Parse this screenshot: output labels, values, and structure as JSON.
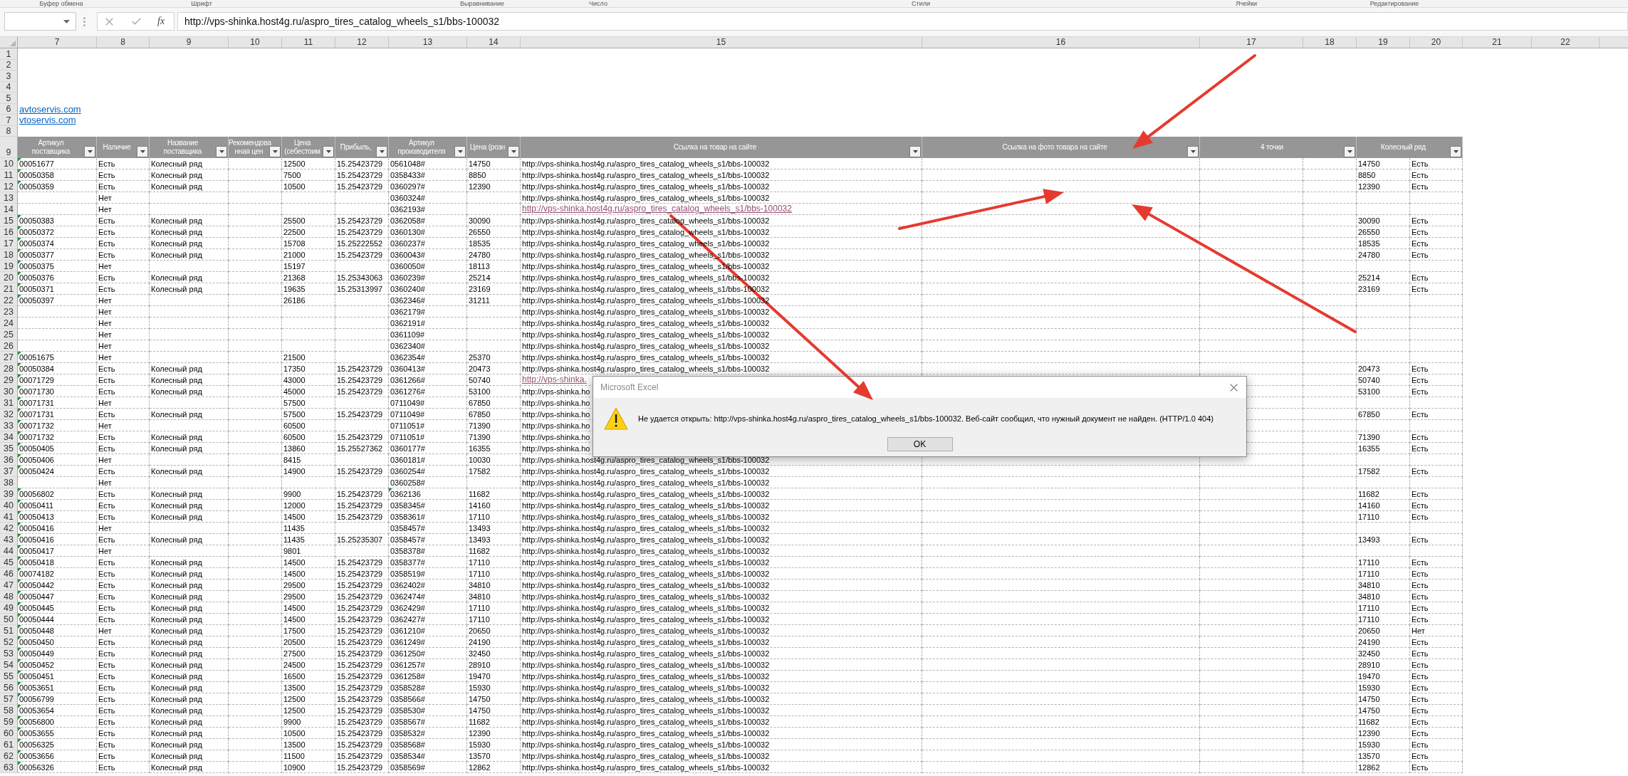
{
  "ribbon_groups": [
    "Буфер обмена",
    "Шрифт",
    "Выравнивание",
    "Число",
    "Стили",
    "Ячейки",
    "Редактирование"
  ],
  "formula_bar": {
    "function_label": "fx",
    "value": "http://vps-shinka.host4g.ru/aspro_tires_catalog_wheels_s1/bbs-100032"
  },
  "column_headers": [
    "7",
    "8",
    "9",
    "10",
    "11",
    "12",
    "13",
    "14",
    "15",
    "16",
    "17",
    "18",
    "19",
    "20",
    "21",
    "22"
  ],
  "top_rows": [
    {
      "row": "1"
    },
    {
      "row": "2"
    },
    {
      "row": "3"
    },
    {
      "row": "4"
    },
    {
      "row": "5"
    },
    {
      "row": "6",
      "text": "avtoservis.com"
    },
    {
      "row": "7",
      "text": "vtoservis.com"
    },
    {
      "row": "8"
    }
  ],
  "table": {
    "row": "9",
    "columns": [
      "Артикул\nпоставщика",
      "Наличие",
      "Название\nпоставщика",
      "Рекомендова\nнная цен",
      "Цена\n(себестоим",
      "Прибыль,",
      "Артикул\nпроизводителя",
      "Цена (розн",
      "Ссылка на товар на сайте",
      "Ссылка на фото товара на сайте",
      "4 точки",
      "Колесный ряд"
    ]
  },
  "rows": [
    {
      "row": "10",
      "article": "00051677",
      "article_flag": true,
      "stock": "Есть",
      "supplier": "Колесный ряд",
      "cost": "12500",
      "profit": "15.25423729",
      "maker_article": "0561048#",
      "maker_flag": false,
      "retail": "14750",
      "link": "http://vps-shinka.host4g.ru/aspro_tires_catalog_wheels_s1/bbs-100032",
      "link_followed": false,
      "column_19": "14750",
      "column_20": "Есть"
    },
    {
      "row": "11",
      "article": "00050358",
      "article_flag": true,
      "stock": "Есть",
      "supplier": "Колесный ряд",
      "cost": "7500",
      "profit": "15.25423729",
      "maker_article": "0358433#",
      "maker_flag": false,
      "retail": "8850",
      "link": "http://vps-shinka.host4g.ru/aspro_tires_catalog_wheels_s1/bbs-100032",
      "link_followed": false,
      "column_19": "8850",
      "column_20": "Есть"
    },
    {
      "row": "12",
      "article": "00050359",
      "article_flag": true,
      "stock": "Есть",
      "supplier": "Колесный ряд",
      "cost": "10500",
      "profit": "15.25423729",
      "maker_article": "0360297#",
      "maker_flag": false,
      "retail": "12390",
      "link": "http://vps-shinka.host4g.ru/aspro_tires_catalog_wheels_s1/bbs-100032",
      "link_followed": false,
      "column_19": "12390",
      "column_20": "Есть"
    },
    {
      "row": "13",
      "article_flag": false,
      "stock": "Нет",
      "maker_article": "0360324#",
      "maker_flag": false,
      "link": "http://vps-shinka.host4g.ru/aspro_tires_catalog_wheels_s1/bbs-100032",
      "link_followed": false
    },
    {
      "row": "14",
      "article_flag": false,
      "stock": "Нет",
      "maker_article": "0362193#",
      "maker_flag": false,
      "link": "http://vps-shinka.host4g.ru/aspro_tires_catalog_wheels_s1/bbs-100032",
      "link_followed": true
    },
    {
      "row": "15",
      "article": "00050383",
      "article_flag": true,
      "stock": "Есть",
      "supplier": "Колесный ряд",
      "cost": "25500",
      "profit": "15.25423729",
      "maker_article": "0362058#",
      "maker_flag": false,
      "retail": "30090",
      "link": "http://vps-shinka.host4g.ru/aspro_tires_catalog_wheels_s1/bbs-100032",
      "link_followed": false,
      "column_19": "30090",
      "column_20": "Есть"
    },
    {
      "row": "16",
      "article": "00050372",
      "article_flag": true,
      "stock": "Есть",
      "supplier": "Колесный ряд",
      "cost": "22500",
      "profit": "15.25423729",
      "maker_article": "0360130#",
      "maker_flag": false,
      "retail": "26550",
      "link": "http://vps-shinka.host4g.ru/aspro_tires_catalog_wheels_s1/bbs-100032",
      "link_followed": false,
      "column_19": "26550",
      "column_20": "Есть"
    },
    {
      "row": "17",
      "article": "00050374",
      "article_flag": true,
      "stock": "Есть",
      "supplier": "Колесный ряд",
      "cost": "15708",
      "profit": "15.25222552",
      "maker_article": "0360237#",
      "maker_flag": false,
      "retail": "18535",
      "link": "http://vps-shinka.host4g.ru/aspro_tires_catalog_wheels_s1/bbs-100032",
      "link_followed": false,
      "column_19": "18535",
      "column_20": "Есть"
    },
    {
      "row": "18",
      "article": "00050377",
      "article_flag": true,
      "stock": "Есть",
      "supplier": "Колесный ряд",
      "cost": "21000",
      "profit": "15.25423729",
      "maker_article": "0360043#",
      "maker_flag": false,
      "retail": "24780",
      "link": "http://vps-shinka.host4g.ru/aspro_tires_catalog_wheels_s1/bbs-100032",
      "link_followed": false,
      "column_19": "24780",
      "column_20": "Есть"
    },
    {
      "row": "19",
      "article": "00050375",
      "article_flag": true,
      "stock": "Нет",
      "cost": "15197",
      "maker_article": "0360050#",
      "maker_flag": false,
      "retail": "18113",
      "link": "http://vps-shinka.host4g.ru/aspro_tires_catalog_wheels_s1/bbs-100032",
      "link_followed": false
    },
    {
      "row": "20",
      "article": "00050376",
      "article_flag": true,
      "stock": "Есть",
      "supplier": "Колесный ряд",
      "cost": "21368",
      "profit": "15.25343063",
      "maker_article": "0360239#",
      "maker_flag": false,
      "retail": "25214",
      "link": "http://vps-shinka.host4g.ru/aspro_tires_catalog_wheels_s1/bbs-100032",
      "link_followed": false,
      "column_19": "25214",
      "column_20": "Есть"
    },
    {
      "row": "21",
      "article": "00050371",
      "article_flag": true,
      "stock": "Есть",
      "supplier": "Колесный ряд",
      "cost": "19635",
      "profit": "15.25313997",
      "maker_article": "0360240#",
      "maker_flag": false,
      "retail": "23169",
      "link": "http://vps-shinka.host4g.ru/aspro_tires_catalog_wheels_s1/bbs-100032",
      "link_followed": false,
      "column_19": "23169",
      "column_20": "Есть"
    },
    {
      "row": "22",
      "article": "00050397",
      "article_flag": true,
      "stock": "Нет",
      "cost": "26186",
      "maker_article": "0362346#",
      "maker_flag": false,
      "retail": "31211",
      "link": "http://vps-shinka.host4g.ru/aspro_tires_catalog_wheels_s1/bbs-100032",
      "link_followed": false
    },
    {
      "row": "23",
      "article_flag": false,
      "stock": "Нет",
      "maker_article": "0362179#",
      "maker_flag": false,
      "link": "http://vps-shinka.host4g.ru/aspro_tires_catalog_wheels_s1/bbs-100032",
      "link_followed": false
    },
    {
      "row": "24",
      "article_flag": false,
      "stock": "Нет",
      "maker_article": "0362191#",
      "maker_flag": false,
      "link": "http://vps-shinka.host4g.ru/aspro_tires_catalog_wheels_s1/bbs-100032",
      "link_followed": false
    },
    {
      "row": "25",
      "article_flag": false,
      "stock": "Нет",
      "maker_article": "0361109#",
      "maker_flag": false,
      "link": "http://vps-shinka.host4g.ru/aspro_tires_catalog_wheels_s1/bbs-100032",
      "link_followed": false
    },
    {
      "row": "26",
      "article_flag": false,
      "stock": "Нет",
      "maker_article": "0362340#",
      "maker_flag": false,
      "link": "http://vps-shinka.host4g.ru/aspro_tires_catalog_wheels_s1/bbs-100032",
      "link_followed": false
    },
    {
      "row": "27",
      "article": "00051675",
      "article_flag": true,
      "stock": "Нет",
      "cost": "21500",
      "maker_article": "0362354#",
      "maker_flag": false,
      "retail": "25370",
      "link": "http://vps-shinka.host4g.ru/aspro_tires_catalog_wheels_s1/bbs-100032",
      "link_followed": false
    },
    {
      "row": "28",
      "article": "00050384",
      "article_flag": true,
      "stock": "Есть",
      "supplier": "Колесный ряд",
      "cost": "17350",
      "profit": "15.25423729",
      "maker_article": "0360413#",
      "maker_flag": false,
      "retail": "20473",
      "link": "http://vps-shinka.host4g.ru/aspro_tires_catalog_wheels_s1/bbs-100032",
      "link_followed": false,
      "column_19": "20473",
      "column_20": "Есть"
    },
    {
      "row": "29",
      "article": "00071729",
      "article_flag": true,
      "stock": "Есть",
      "supplier": "Колесный ряд",
      "cost": "43000",
      "profit": "15.25423729",
      "maker_article": "0361266#",
      "maker_flag": false,
      "retail": "50740",
      "link": "http://vps-shinka.",
      "link_followed": true,
      "column_19": "50740",
      "column_20": "Есть"
    },
    {
      "row": "30",
      "article": "00071730",
      "article_flag": true,
      "stock": "Есть",
      "supplier": "Колесный ряд",
      "cost": "45000",
      "profit": "15.25423729",
      "maker_article": "0361276#",
      "maker_flag": false,
      "retail": "53100",
      "link": "http://vps-shinka.ho",
      "link_followed": false,
      "column_19": "53100",
      "column_20": "Есть"
    },
    {
      "row": "31",
      "article": "00071731",
      "article_flag": true,
      "stock": "Нет",
      "cost": "57500",
      "maker_article": "0711049#",
      "maker_flag": false,
      "retail": "67850",
      "link": "http://vps-shinka.ho",
      "link_followed": false
    },
    {
      "row": "32",
      "article": "00071731",
      "article_flag": true,
      "stock": "Есть",
      "supplier": "Колесный ряд",
      "cost": "57500",
      "profit": "15.25423729",
      "maker_article": "0711049#",
      "maker_flag": false,
      "retail": "67850",
      "link": "http://vps-shinka.ho",
      "link_followed": false,
      "column_19": "67850",
      "column_20": "Есть"
    },
    {
      "row": "33",
      "article": "00071732",
      "article_flag": true,
      "stock": "Нет",
      "cost": "60500",
      "maker_article": "0711051#",
      "maker_flag": false,
      "retail": "71390",
      "link": "http://vps-shinka.ho",
      "link_followed": false
    },
    {
      "row": "34",
      "article": "00071732",
      "article_flag": true,
      "stock": "Есть",
      "supplier": "Колесный ряд",
      "cost": "60500",
      "profit": "15.25423729",
      "maker_article": "0711051#",
      "maker_flag": false,
      "retail": "71390",
      "link": "http://vps-shinka.ho",
      "link_followed": false,
      "column_19": "71390",
      "column_20": "Есть"
    },
    {
      "row": "35",
      "article": "00050405",
      "article_flag": true,
      "stock": "Есть",
      "supplier": "Колесный ряд",
      "cost": "13860",
      "profit": "15.25527362",
      "maker_article": "0360177#",
      "maker_flag": false,
      "retail": "16355",
      "link": "http://vps-shinka.ho",
      "link_followed": false,
      "column_19": "16355",
      "column_20": "Есть"
    },
    {
      "row": "36",
      "article": "00050406",
      "article_flag": true,
      "stock": "Нет",
      "cost": "8415",
      "maker_article": "0360181#",
      "maker_flag": false,
      "retail": "10030",
      "link": "http://vps-shinka.host4g.ru/aspro_tires_catalog_wheels_s1/bbs-100032",
      "link_followed": false
    },
    {
      "row": "37",
      "article": "00050424",
      "article_flag": true,
      "stock": "Есть",
      "supplier": "Колесный ряд",
      "cost": "14900",
      "profit": "15.25423729",
      "maker_article": "0360254#",
      "maker_flag": false,
      "retail": "17582",
      "link": "http://vps-shinka.host4g.ru/aspro_tires_catalog_wheels_s1/bbs-100032",
      "link_followed": false,
      "column_19": "17582",
      "column_20": "Есть"
    },
    {
      "row": "38",
      "article_flag": false,
      "stock": "Нет",
      "maker_article": "0360258#",
      "maker_flag": false,
      "link": "http://vps-shinka.host4g.ru/aspro_tires_catalog_wheels_s1/bbs-100032",
      "link_followed": false
    },
    {
      "row": "39",
      "article": "00056802",
      "article_flag": true,
      "stock": "Есть",
      "supplier": "Колесный ряд",
      "cost": "9900",
      "profit": "15.25423729",
      "maker_article": "0362136",
      "maker_flag": true,
      "retail": "11682",
      "link": "http://vps-shinka.host4g.ru/aspro_tires_catalog_wheels_s1/bbs-100032",
      "link_followed": false,
      "column_19": "11682",
      "column_20": "Есть"
    },
    {
      "row": "40",
      "article": "00050411",
      "article_flag": true,
      "stock": "Есть",
      "supplier": "Колесный ряд",
      "cost": "12000",
      "profit": "15.25423729",
      "maker_article": "0358345#",
      "maker_flag": false,
      "retail": "14160",
      "link": "http://vps-shinka.host4g.ru/aspro_tires_catalog_wheels_s1/bbs-100032",
      "link_followed": false,
      "column_19": "14160",
      "column_20": "Есть"
    },
    {
      "row": "41",
      "article": "00050413",
      "article_flag": true,
      "stock": "Есть",
      "supplier": "Колесный ряд",
      "cost": "14500",
      "profit": "15.25423729",
      "maker_article": "0358361#",
      "maker_flag": false,
      "retail": "17110",
      "link": "http://vps-shinka.host4g.ru/aspro_tires_catalog_wheels_s1/bbs-100032",
      "link_followed": false,
      "column_19": "17110",
      "column_20": "Есть"
    },
    {
      "row": "42",
      "article": "00050416",
      "article_flag": true,
      "stock": "Нет",
      "cost": "11435",
      "maker_article": "0358457#",
      "maker_flag": false,
      "retail": "13493",
      "link": "http://vps-shinka.host4g.ru/aspro_tires_catalog_wheels_s1/bbs-100032",
      "link_followed": false
    },
    {
      "row": "43",
      "article": "00050416",
      "article_flag": true,
      "stock": "Есть",
      "supplier": "Колесный ряд",
      "cost": "11435",
      "profit": "15.25235307",
      "maker_article": "0358457#",
      "maker_flag": false,
      "retail": "13493",
      "link": "http://vps-shinka.host4g.ru/aspro_tires_catalog_wheels_s1/bbs-100032",
      "link_followed": false,
      "column_19": "13493",
      "column_20": "Есть"
    },
    {
      "row": "44",
      "article": "00050417",
      "article_flag": true,
      "stock": "Нет",
      "cost": "9801",
      "maker_article": "0358378#",
      "maker_flag": false,
      "retail": "11682",
      "link": "http://vps-shinka.host4g.ru/aspro_tires_catalog_wheels_s1/bbs-100032",
      "link_followed": false
    },
    {
      "row": "45",
      "article": "00050418",
      "article_flag": true,
      "stock": "Есть",
      "supplier": "Колесный ряд",
      "cost": "14500",
      "profit": "15.25423729",
      "maker_article": "0358377#",
      "maker_flag": false,
      "retail": "17110",
      "link": "http://vps-shinka.host4g.ru/aspro_tires_catalog_wheels_s1/bbs-100032",
      "link_followed": false,
      "column_19": "17110",
      "column_20": "Есть"
    },
    {
      "row": "46",
      "article": "00074182",
      "article_flag": true,
      "stock": "Есть",
      "supplier": "Колесный ряд",
      "cost": "14500",
      "profit": "15.25423729",
      "maker_article": "0358519#",
      "maker_flag": false,
      "retail": "17110",
      "link": "http://vps-shinka.host4g.ru/aspro_tires_catalog_wheels_s1/bbs-100032",
      "link_followed": false,
      "column_19": "17110",
      "column_20": "Есть"
    },
    {
      "row": "47",
      "article": "00050442",
      "article_flag": true,
      "stock": "Есть",
      "supplier": "Колесный ряд",
      "cost": "29500",
      "profit": "15.25423729",
      "maker_article": "0362402#",
      "maker_flag": false,
      "retail": "34810",
      "link": "http://vps-shinka.host4g.ru/aspro_tires_catalog_wheels_s1/bbs-100032",
      "link_followed": false,
      "column_19": "34810",
      "column_20": "Есть"
    },
    {
      "row": "48",
      "article": "00050447",
      "article_flag": true,
      "stock": "Есть",
      "supplier": "Колесный ряд",
      "cost": "29500",
      "profit": "15.25423729",
      "maker_article": "0362474#",
      "maker_flag": false,
      "retail": "34810",
      "link": "http://vps-shinka.host4g.ru/aspro_tires_catalog_wheels_s1/bbs-100032",
      "link_followed": false,
      "column_19": "34810",
      "column_20": "Есть"
    },
    {
      "row": "49",
      "article": "00050445",
      "article_flag": true,
      "stock": "Есть",
      "supplier": "Колесный ряд",
      "cost": "14500",
      "profit": "15.25423729",
      "maker_article": "0362429#",
      "maker_flag": false,
      "retail": "17110",
      "link": "http://vps-shinka.host4g.ru/aspro_tires_catalog_wheels_s1/bbs-100032",
      "link_followed": false,
      "column_19": "17110",
      "column_20": "Есть"
    },
    {
      "row": "50",
      "article": "00050444",
      "article_flag": true,
      "stock": "Есть",
      "supplier": "Колесный ряд",
      "cost": "14500",
      "profit": "15.25423729",
      "maker_article": "0362427#",
      "maker_flag": false,
      "retail": "17110",
      "link": "http://vps-shinka.host4g.ru/aspro_tires_catalog_wheels_s1/bbs-100032",
      "link_followed": false,
      "column_19": "17110",
      "column_20": "Есть"
    },
    {
      "row": "51",
      "article": "00050448",
      "article_flag": true,
      "stock": "Нет",
      "supplier": "Колесный ряд",
      "cost": "17500",
      "profit": "15.25423729",
      "maker_article": "0361210#",
      "maker_flag": false,
      "retail": "20650",
      "link": "http://vps-shinka.host4g.ru/aspro_tires_catalog_wheels_s1/bbs-100032",
      "link_followed": false,
      "column_19": "20650",
      "column_20": "Нет"
    },
    {
      "row": "52",
      "article": "00050450",
      "article_flag": true,
      "stock": "Есть",
      "supplier": "Колесный ряд",
      "cost": "20500",
      "profit": "15.25423729",
      "maker_article": "0361249#",
      "maker_flag": false,
      "retail": "24190",
      "link": "http://vps-shinka.host4g.ru/aspro_tires_catalog_wheels_s1/bbs-100032",
      "link_followed": false,
      "column_19": "24190",
      "column_20": "Есть"
    },
    {
      "row": "53",
      "article": "00050449",
      "article_flag": true,
      "stock": "Есть",
      "supplier": "Колесный ряд",
      "cost": "27500",
      "profit": "15.25423729",
      "maker_article": "0361250#",
      "maker_flag": false,
      "retail": "32450",
      "link": "http://vps-shinka.host4g.ru/aspro_tires_catalog_wheels_s1/bbs-100032",
      "link_followed": false,
      "column_19": "32450",
      "column_20": "Есть"
    },
    {
      "row": "54",
      "article": "00050452",
      "article_flag": true,
      "stock": "Есть",
      "supplier": "Колесный ряд",
      "cost": "24500",
      "profit": "15.25423729",
      "maker_article": "0361257#",
      "maker_flag": false,
      "retail": "28910",
      "link": "http://vps-shinka.host4g.ru/aspro_tires_catalog_wheels_s1/bbs-100032",
      "link_followed": false,
      "column_19": "28910",
      "column_20": "Есть"
    },
    {
      "row": "55",
      "article": "00050451",
      "article_flag": true,
      "stock": "Есть",
      "supplier": "Колесный ряд",
      "cost": "16500",
      "profit": "15.25423729",
      "maker_article": "0361258#",
      "maker_flag": false,
      "retail": "19470",
      "link": "http://vps-shinka.host4g.ru/aspro_tires_catalog_wheels_s1/bbs-100032",
      "link_followed": false,
      "column_19": "19470",
      "column_20": "Есть"
    },
    {
      "row": "56",
      "article": "00053651",
      "article_flag": true,
      "stock": "Есть",
      "supplier": "Колесный ряд",
      "cost": "13500",
      "profit": "15.25423729",
      "maker_article": "0358528#",
      "maker_flag": false,
      "retail": "15930",
      "link": "http://vps-shinka.host4g.ru/aspro_tires_catalog_wheels_s1/bbs-100032",
      "link_followed": false,
      "column_19": "15930",
      "column_20": "Есть"
    },
    {
      "row": "57",
      "article": "00056799",
      "article_flag": true,
      "stock": "Есть",
      "supplier": "Колесный ряд",
      "cost": "12500",
      "profit": "15.25423729",
      "maker_article": "0358566#",
      "maker_flag": false,
      "retail": "14750",
      "link": "http://vps-shinka.host4g.ru/aspro_tires_catalog_wheels_s1/bbs-100032",
      "link_followed": false,
      "column_19": "14750",
      "column_20": "Есть"
    },
    {
      "row": "58",
      "article": "00053654",
      "article_flag": true,
      "stock": "Есть",
      "supplier": "Колесный ряд",
      "cost": "12500",
      "profit": "15.25423729",
      "maker_article": "0358530#",
      "maker_flag": false,
      "retail": "14750",
      "link": "http://vps-shinka.host4g.ru/aspro_tires_catalog_wheels_s1/bbs-100032",
      "link_followed": false,
      "column_19": "14750",
      "column_20": "Есть"
    },
    {
      "row": "59",
      "article": "00056800",
      "article_flag": true,
      "stock": "Есть",
      "supplier": "Колесный ряд",
      "cost": "9900",
      "profit": "15.25423729",
      "maker_article": "0358567#",
      "maker_flag": false,
      "retail": "11682",
      "link": "http://vps-shinka.host4g.ru/aspro_tires_catalog_wheels_s1/bbs-100032",
      "link_followed": false,
      "column_19": "11682",
      "column_20": "Есть"
    },
    {
      "row": "60",
      "article": "00053655",
      "article_flag": true,
      "stock": "Есть",
      "supplier": "Колесный ряд",
      "cost": "10500",
      "profit": "15.25423729",
      "maker_article": "0358532#",
      "maker_flag": false,
      "retail": "12390",
      "link": "http://vps-shinka.host4g.ru/aspro_tires_catalog_wheels_s1/bbs-100032",
      "link_followed": false,
      "column_19": "12390",
      "column_20": "Есть"
    },
    {
      "row": "61",
      "article": "00056325",
      "article_flag": true,
      "stock": "Есть",
      "supplier": "Колесный ряд",
      "cost": "13500",
      "profit": "15.25423729",
      "maker_article": "0358568#",
      "maker_flag": false,
      "retail": "15930",
      "link": "http://vps-shinka.host4g.ru/aspro_tires_catalog_wheels_s1/bbs-100032",
      "link_followed": false,
      "column_19": "15930",
      "column_20": "Есть"
    },
    {
      "row": "62",
      "article": "00053656",
      "article_flag": true,
      "stock": "Есть",
      "supplier": "Колесный ряд",
      "cost": "11500",
      "profit": "15.25423729",
      "maker_article": "0358534#",
      "maker_flag": false,
      "retail": "13570",
      "link": "http://vps-shinka.host4g.ru/aspro_tires_catalog_wheels_s1/bbs-100032",
      "link_followed": false,
      "column_19": "13570",
      "column_20": "Есть"
    },
    {
      "row": "63",
      "article": "00056326",
      "article_flag": true,
      "stock": "Есть",
      "supplier": "Колесный ряд",
      "cost": "10900",
      "profit": "15.25423729",
      "maker_article": "0358569#",
      "maker_flag": false,
      "retail": "12862",
      "link": "http://vps-shinka.host4g.ru/aspro_tires_catalog_wheels_s1/bbs-100032",
      "link_followed": false,
      "column_19": "12862",
      "column_20": "Есть"
    }
  ],
  "dialog": {
    "title": "Microsoft Excel",
    "message": "Не удается открыть: http://vps-shinka.host4g.ru/aspro_tires_catalog_wheels_s1/bbs-100032. Веб-сайт сообщил, что нужный документ не найден. (HTTP/1.0 404)",
    "buttons": [
      "OK"
    ]
  }
}
